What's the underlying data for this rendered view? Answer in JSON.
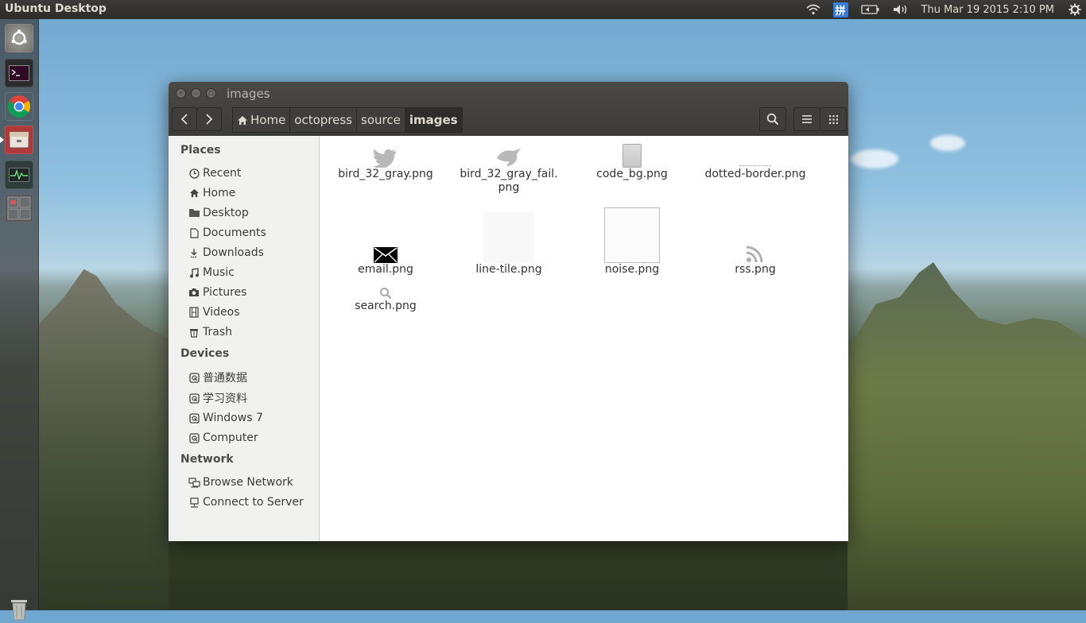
{
  "desktop": {
    "panel_title": "Ubuntu Desktop",
    "clock": "Thu Mar 19 2015  2:10 PM",
    "ime_label": "拼"
  },
  "launcher": {
    "items": [
      "ubuntu-dash",
      "terminal",
      "chrome",
      "files",
      "system-monitor",
      "workspaces"
    ],
    "trash": "trash"
  },
  "window": {
    "title": "images",
    "pathbar": [
      "Home",
      "octopress",
      "source",
      "images"
    ]
  },
  "sidebar": {
    "places_title": "Places",
    "places": [
      {
        "label": "Recent",
        "icon": "clock-icon"
      },
      {
        "label": "Home",
        "icon": "home-icon"
      },
      {
        "label": "Desktop",
        "icon": "folder-icon"
      },
      {
        "label": "Documents",
        "icon": "document-icon"
      },
      {
        "label": "Downloads",
        "icon": "download-icon"
      },
      {
        "label": "Music",
        "icon": "music-icon"
      },
      {
        "label": "Pictures",
        "icon": "camera-icon"
      },
      {
        "label": "Videos",
        "icon": "film-icon"
      },
      {
        "label": "Trash",
        "icon": "trash-icon"
      }
    ],
    "devices_title": "Devices",
    "devices": [
      {
        "label": "普通数据"
      },
      {
        "label": "学习资料"
      },
      {
        "label": "Windows 7"
      },
      {
        "label": "Computer"
      }
    ],
    "network_title": "Network",
    "network": [
      {
        "label": "Browse Network"
      },
      {
        "label": "Connect to Server"
      }
    ]
  },
  "files": [
    {
      "name": "bird_32_gray.png",
      "icon": "twitter-bird-icon"
    },
    {
      "name": "bird_32_gray_fail.\npng",
      "icon": "bird-fail-icon"
    },
    {
      "name": "code_bg.png",
      "icon": "code-bg-icon"
    },
    {
      "name": "dotted-border.png",
      "icon": "dotted-border-icon"
    },
    {
      "name": "email.png",
      "icon": "envelope-icon"
    },
    {
      "name": "line-tile.png",
      "icon": "line-tile-icon"
    },
    {
      "name": "noise.png",
      "icon": "noise-icon"
    },
    {
      "name": "rss.png",
      "icon": "rss-icon"
    },
    {
      "name": "search.png",
      "icon": "search-icon"
    }
  ]
}
